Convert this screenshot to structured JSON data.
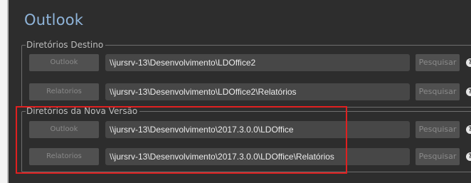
{
  "title": "Outlook",
  "groups": [
    {
      "legend": "Diretórios Destino",
      "rows": [
        {
          "button": "Outlook",
          "path": "\\\\jursrv-13\\Desenvolvimento\\LDOffice2",
          "search": "Pesquisar",
          "help": "?"
        },
        {
          "button": "Relatorios",
          "path": "\\\\jursrv-13\\Desenvolvimento\\LDOffice2\\Relatórios",
          "search": "Pesquisar",
          "help": "?"
        }
      ]
    },
    {
      "legend": "Diretórios da Nova Versão",
      "rows": [
        {
          "button": "Outlook",
          "path": "\\\\jursrv-13\\Desenvolvimento\\2017.3.0.0\\LDOffice",
          "search": "Pesquisar",
          "help": "?"
        },
        {
          "button": "Relatorios",
          "path": "\\\\jursrv-13\\Desenvolvimento\\2017.3.0.0\\LDOffice\\Relatórios",
          "search": "Pesquisar",
          "help": "?"
        }
      ]
    }
  ],
  "colors": {
    "panel_bg": "#2d2d2d",
    "title": "#8fb4d9",
    "highlight": "#e02020"
  }
}
